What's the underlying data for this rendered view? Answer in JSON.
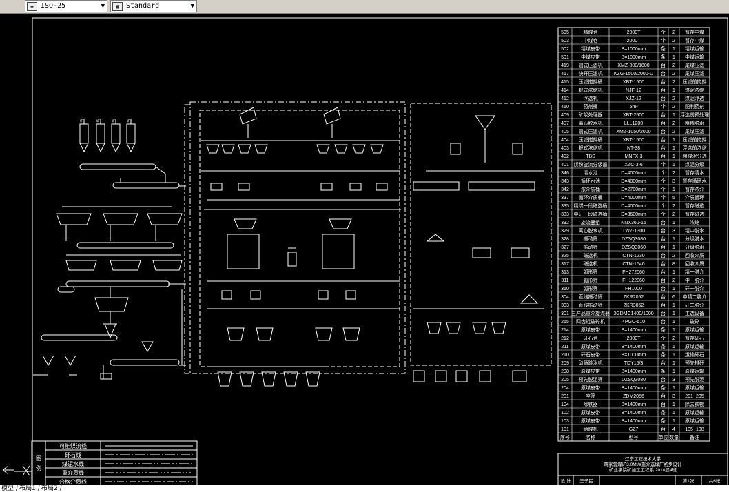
{
  "toolbar": {
    "dim_style": "ISO-25",
    "table_style": "Standard"
  },
  "tabs": [
    "模型",
    "布局1",
    "布局2"
  ],
  "legend": {
    "side_title": "图例",
    "items": [
      "可能煤流线",
      "矸石线",
      "煤泥水线",
      "重介质线",
      "合格介质线"
    ]
  },
  "title_block": {
    "lines": [
      "辽宁工程技术大学",
      "晓家营煤矿3.0Mt/a重介选煤厂初步设计",
      "矿业学院矿加工工程系 2010届4班"
    ],
    "designer_label": "设 计",
    "designer": "王子民",
    "sheet_no": "第1张",
    "total": "共6张"
  },
  "equipment_table": {
    "header": [
      "序号",
      "名称",
      "型号",
      "单位",
      "数量",
      "备注"
    ],
    "rows": [
      [
        "505",
        "精煤仓",
        "2000T",
        "个",
        "2",
        "暂存中煤"
      ],
      [
        "503",
        "中煤仓",
        "2000T",
        "个",
        "2",
        "暂存中煤"
      ],
      [
        "502",
        "精煤皮带",
        "B=1000mm",
        "条",
        "1",
        "精煤运输"
      ],
      [
        "501",
        "中煤皮带",
        "B=1000mm",
        "条",
        "1",
        "中煤运输"
      ],
      [
        "419",
        "圆式压滤机",
        "XMZ-800/1800",
        "台",
        "2",
        "尾煤压滤"
      ],
      [
        "417",
        "快开压滤机",
        "KZG-1500/2000-U",
        "台",
        "2",
        "尾煤压滤"
      ],
      [
        "415",
        "压滤搅拌桶",
        "XBT-1500",
        "台",
        "2",
        "压滤前搅拌"
      ],
      [
        "414",
        "耙式浓缩机",
        "NJF-12",
        "台",
        "1",
        "煤泥浓缩"
      ],
      [
        "412",
        "浮选机",
        "XJZ-12",
        "台",
        "2",
        "煤泥浮选"
      ],
      [
        "410",
        "药剂桶",
        "5m³",
        "个",
        "2",
        "配制药剂"
      ],
      [
        "409",
        "矿浆处理器",
        "XBT-2500",
        "台",
        "1",
        "浮选前预处理"
      ],
      [
        "407",
        "离心脱水机",
        "LLL1200",
        "台",
        "2",
        "粗精脱水"
      ],
      [
        "405",
        "圆式压滤机",
        "XMZ-1050/2000",
        "台",
        "2",
        "尾煤压滤"
      ],
      [
        "404",
        "压滤搅拌桶",
        "XBT-1500",
        "台",
        "1",
        "压滤前搅拌"
      ],
      [
        "403",
        "耙式浓缩机",
        "NT-38",
        "台",
        "1",
        "浮选前浓缩"
      ],
      [
        "402",
        "TBS",
        "MNFX-3",
        "台",
        "1",
        "粗煤泥分选"
      ],
      [
        "401",
        "煤粉旋流分级器",
        "XZC-3-6",
        "个",
        "1",
        "煤泥分级"
      ],
      [
        "346",
        "清水池",
        "D=4000mm",
        "个",
        "2",
        "暂存清水"
      ],
      [
        "343",
        "循环水池",
        "D=4000mm",
        "个",
        "3",
        "暂存循环水"
      ],
      [
        "342",
        "浓介质桶",
        "D=2700mm",
        "个",
        "1",
        "暂存浓介"
      ],
      [
        "337",
        "循环介质桶",
        "D=4000mm",
        "个",
        "5",
        "介质循环"
      ],
      [
        "335",
        "精煤一段磁选桶",
        "D=4000mm",
        "个",
        "2",
        "暂存磁选"
      ],
      [
        "333",
        "中矸一段磁选桶",
        "D=3600mm",
        "个",
        "2",
        "暂存磁选"
      ],
      [
        "332",
        "旋流器组",
        "NNX360-16",
        "台",
        "1",
        "浓缩"
      ],
      [
        "329",
        "离心脱水机",
        "TWZ-1300",
        "台",
        "3",
        "精中脱水"
      ],
      [
        "328",
        "振动筛",
        "DZSQ3080",
        "台",
        "1",
        "分级脱水"
      ],
      [
        "327",
        "振动筛",
        "DZSQ3060",
        "台",
        "1",
        "分级脱水"
      ],
      [
        "325",
        "磁选机",
        "CTN-1230",
        "台",
        "2",
        "回收介质"
      ],
      [
        "317",
        "磁选机",
        "CTN-1540",
        "台",
        "8",
        "回收介质"
      ],
      [
        "313",
        "弧形筛",
        "FH272060",
        "台",
        "1",
        "精一脱介"
      ],
      [
        "311",
        "弧形筛",
        "FH122060",
        "台",
        "2",
        "中一脱介"
      ],
      [
        "310",
        "弧形筛",
        "FH1000",
        "台",
        "1",
        "矸一脱介"
      ],
      [
        "304",
        "直线振动筛",
        "ZKR2052",
        "台",
        "6",
        "中精二脱介"
      ],
      [
        "303",
        "直线振动筛",
        "ZKR3052",
        "台",
        "1",
        "矸二脱介"
      ],
      [
        "301",
        "三产品重介旋流器",
        "3GDMC1400/1000",
        "台",
        "1",
        "主选设备"
      ],
      [
        "215",
        "四齿辊破碎机",
        "4PGC-510",
        "台",
        "1",
        "破碎"
      ],
      [
        "214",
        "原煤皮带",
        "B=1400mm",
        "条",
        "1",
        "原煤运输"
      ],
      [
        "212",
        "矸石仓",
        "2000T",
        "个",
        "2",
        "暂存矸石"
      ],
      [
        "211",
        "原煤皮带",
        "B=1400mm",
        "条",
        "1",
        "原煤运输"
      ],
      [
        "210",
        "矸石皮带",
        "B=1000mm",
        "条",
        "1",
        "运输矸石"
      ],
      [
        "209",
        "动筛跳汰机",
        "TDY15/3",
        "台",
        "1",
        "预先排矸"
      ],
      [
        "208",
        "原煤皮带",
        "B=1400mm",
        "条",
        "1",
        "原煤运输"
      ],
      [
        "205",
        "预先脱泥筛",
        "DZSQ3080",
        "台",
        "3",
        "预先脱泥"
      ],
      [
        "204",
        "原煤皮带",
        "B=1400mm",
        "条",
        "1",
        "原煤运输"
      ],
      [
        "201",
        "座筛",
        "ZDM2056",
        "台",
        "3",
        "201~205"
      ],
      [
        "104",
        "除铁器",
        "B=1400mm",
        "台",
        "1",
        "除去铁物"
      ],
      [
        "102",
        "原煤皮带",
        "B=1400mm",
        "条",
        "1",
        "原煤运输"
      ],
      [
        "103",
        "原煤皮带",
        "B=1400mm",
        "条",
        "1",
        "原煤运输"
      ],
      [
        "101",
        "给煤机",
        "GZ7",
        "台",
        "4",
        "105~108"
      ]
    ]
  },
  "diagram_labels": {
    "coal_bins": [
      "矿",
      "矿",
      "矿",
      "矿"
    ]
  }
}
